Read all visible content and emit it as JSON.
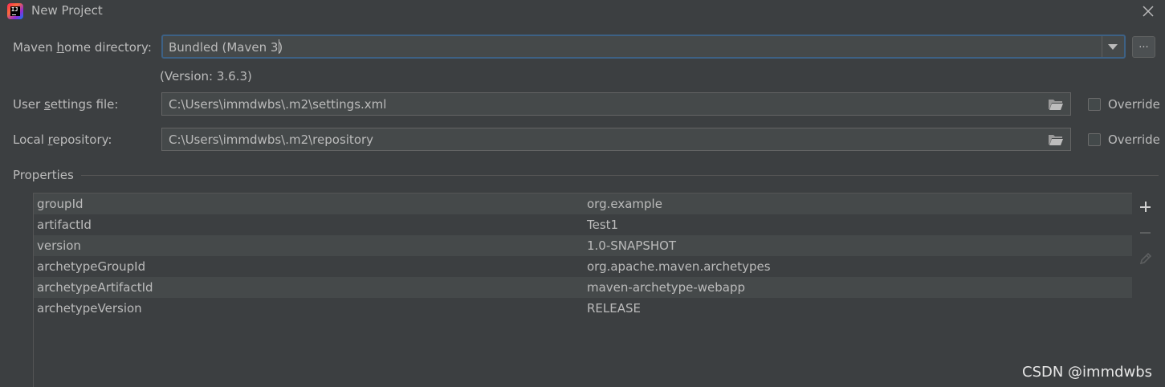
{
  "window": {
    "title": "New Project"
  },
  "maven_home": {
    "label_prefix": "Maven ",
    "label_mnemonic": "h",
    "label_suffix": "ome directory:",
    "value": "Bundled (Maven 3)",
    "browse_label": "...",
    "version_text": "(Version: 3.6.3)"
  },
  "user_settings": {
    "label_prefix": "User ",
    "label_mnemonic": "s",
    "label_suffix": "ettings file:",
    "value": "C:\\Users\\immdwbs\\.m2\\settings.xml",
    "override_label": "Override",
    "override_checked": false
  },
  "local_repository": {
    "label_prefix": "Local ",
    "label_mnemonic": "r",
    "label_suffix": "epository:",
    "value": "C:\\Users\\immdwbs\\.m2\\repository",
    "override_label": "Override",
    "override_checked": false
  },
  "properties": {
    "title": "Properties",
    "rows": [
      {
        "key": "groupId",
        "value": "org.example"
      },
      {
        "key": "artifactId",
        "value": "Test1"
      },
      {
        "key": "version",
        "value": "1.0-SNAPSHOT"
      },
      {
        "key": "archetypeGroupId",
        "value": "org.apache.maven.archetypes"
      },
      {
        "key": "archetypeArtifactId",
        "value": "maven-archetype-webapp"
      },
      {
        "key": "archetypeVersion",
        "value": "RELEASE"
      }
    ],
    "toolbar": {
      "add_icon": "plus-icon",
      "remove_icon": "minus-icon",
      "edit_icon": "pencil-icon"
    }
  },
  "watermark": "CSDN @immdwbs",
  "colors": {
    "background": "#3c3f41",
    "field_bg": "#45494a",
    "focus_border": "#3d6185",
    "text": "#bbbbbb",
    "row_alt": "#45494a"
  }
}
